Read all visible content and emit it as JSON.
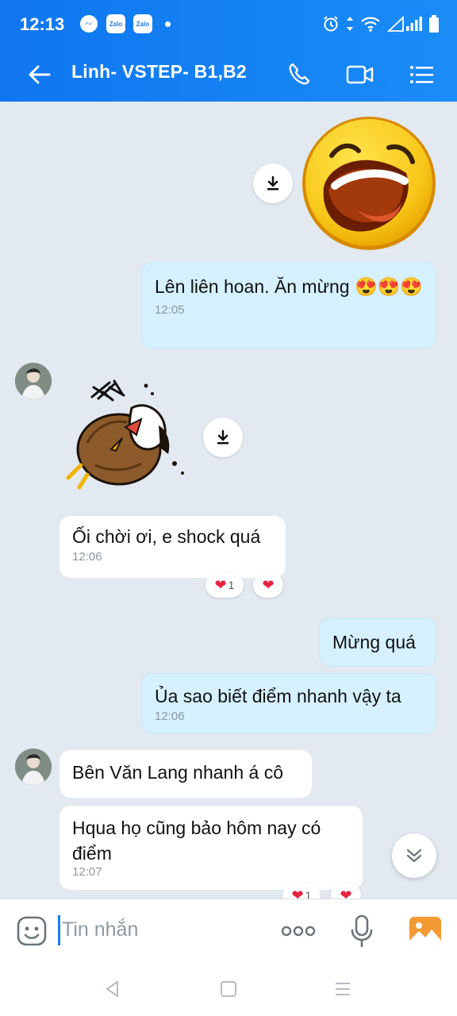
{
  "status_bar": {
    "time": "12:13",
    "apps": [
      "Zalo",
      "Zalo"
    ]
  },
  "header": {
    "title": "Linh- VSTEP- B1,B2"
  },
  "messages": {
    "m1": {
      "text": "Lên liên hoan. Ăn mừng 😍😍😍",
      "time": "12:05"
    },
    "m2": {
      "text": "Ối chời ơi, e shock quá",
      "time": "12:06"
    },
    "m2_reaction_count": "1",
    "m3": {
      "text": "Mừng quá"
    },
    "m4": {
      "text": "Ủa sao biết điểm nhanh vậy ta",
      "time": "12:06"
    },
    "m5": {
      "text": "Bên Văn Lang nhanh á cô"
    },
    "m6": {
      "text": "Hqua họ cũng bảo hôm nay có điểm",
      "time": "12:07"
    },
    "m6_reaction_count": "1"
  },
  "input": {
    "placeholder": "Tin nhắn"
  },
  "colors": {
    "header_blue": "#1a7cf0",
    "outgoing_bubble": "#d5f1ff",
    "incoming_bubble": "#ffffff",
    "chat_bg": "#e2e9f1",
    "reaction_heart": "#e8233f"
  }
}
